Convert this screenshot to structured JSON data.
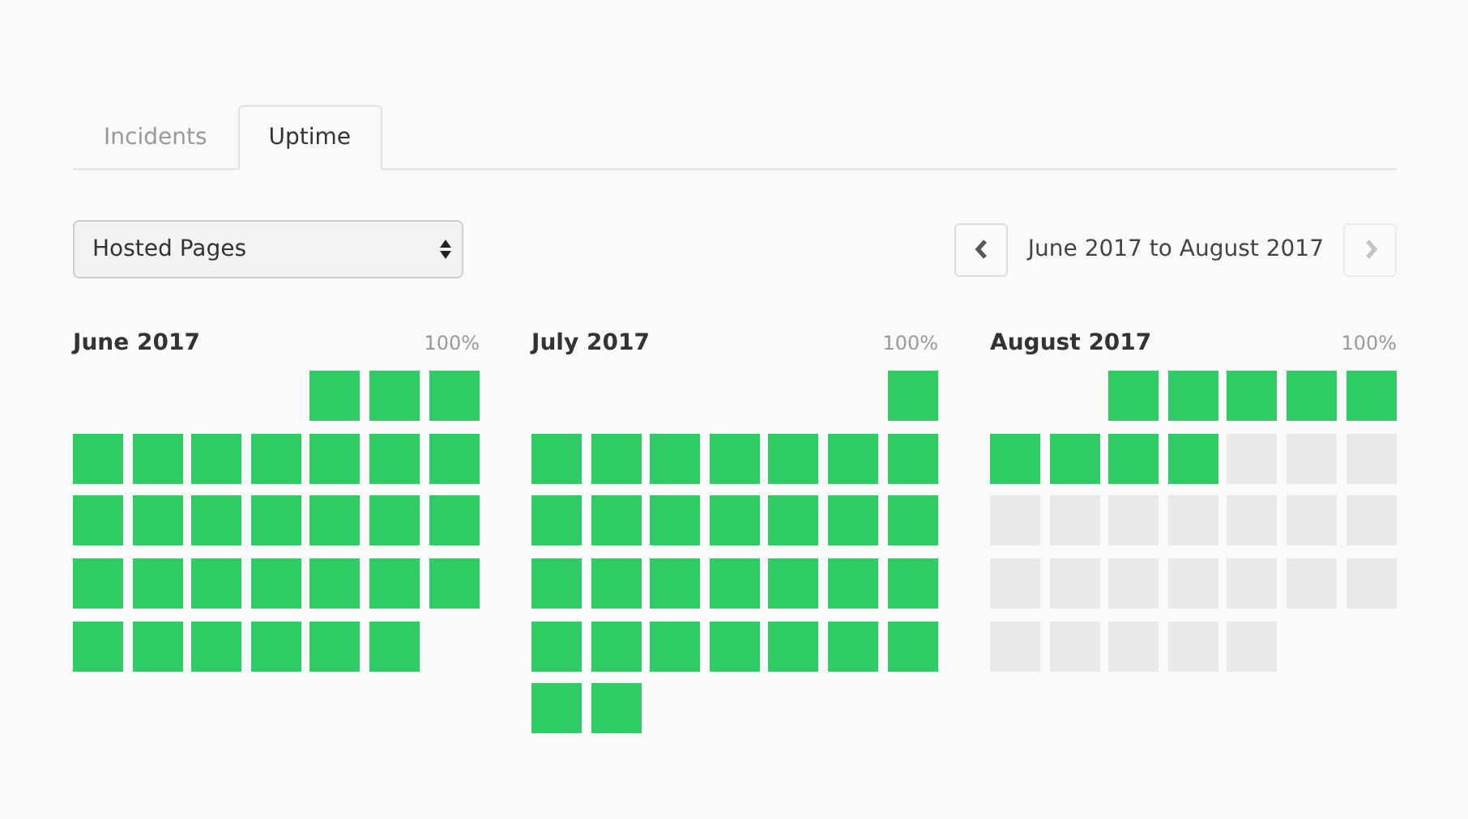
{
  "tabs": [
    {
      "label": "Incidents",
      "selected": false
    },
    {
      "label": "Uptime",
      "selected": true
    }
  ],
  "component_select": {
    "value": "Hosted Pages"
  },
  "range": {
    "label": "June 2017 to August 2017",
    "prev_disabled": false,
    "next_disabled": true
  },
  "months": [
    {
      "title": "June 2017",
      "uptime": "100%",
      "days": [
        {
          "kind": "blank"
        },
        {
          "kind": "blank"
        },
        {
          "kind": "blank"
        },
        {
          "kind": "blank"
        },
        {
          "kind": "up"
        },
        {
          "kind": "up"
        },
        {
          "kind": "up"
        },
        {
          "kind": "up"
        },
        {
          "kind": "up"
        },
        {
          "kind": "up"
        },
        {
          "kind": "up"
        },
        {
          "kind": "up"
        },
        {
          "kind": "up"
        },
        {
          "kind": "up"
        },
        {
          "kind": "up"
        },
        {
          "kind": "up"
        },
        {
          "kind": "up"
        },
        {
          "kind": "up"
        },
        {
          "kind": "up"
        },
        {
          "kind": "up"
        },
        {
          "kind": "up"
        },
        {
          "kind": "up"
        },
        {
          "kind": "up"
        },
        {
          "kind": "up"
        },
        {
          "kind": "up"
        },
        {
          "kind": "up"
        },
        {
          "kind": "up"
        },
        {
          "kind": "up"
        },
        {
          "kind": "up"
        },
        {
          "kind": "up"
        },
        {
          "kind": "up"
        },
        {
          "kind": "up"
        },
        {
          "kind": "up"
        },
        {
          "kind": "up"
        }
      ]
    },
    {
      "title": "July 2017",
      "uptime": "100%",
      "days": [
        {
          "kind": "blank"
        },
        {
          "kind": "blank"
        },
        {
          "kind": "blank"
        },
        {
          "kind": "blank"
        },
        {
          "kind": "blank"
        },
        {
          "kind": "blank"
        },
        {
          "kind": "up"
        },
        {
          "kind": "up"
        },
        {
          "kind": "up"
        },
        {
          "kind": "up"
        },
        {
          "kind": "up"
        },
        {
          "kind": "up"
        },
        {
          "kind": "up"
        },
        {
          "kind": "up"
        },
        {
          "kind": "up"
        },
        {
          "kind": "up"
        },
        {
          "kind": "up"
        },
        {
          "kind": "up"
        },
        {
          "kind": "up"
        },
        {
          "kind": "up"
        },
        {
          "kind": "up"
        },
        {
          "kind": "up"
        },
        {
          "kind": "up"
        },
        {
          "kind": "up"
        },
        {
          "kind": "up"
        },
        {
          "kind": "up"
        },
        {
          "kind": "up"
        },
        {
          "kind": "up"
        },
        {
          "kind": "up"
        },
        {
          "kind": "up"
        },
        {
          "kind": "up"
        },
        {
          "kind": "up"
        },
        {
          "kind": "up"
        },
        {
          "kind": "up"
        },
        {
          "kind": "up"
        },
        {
          "kind": "up"
        },
        {
          "kind": "up"
        }
      ]
    },
    {
      "title": "August 2017",
      "uptime": "100%",
      "days": [
        {
          "kind": "blank"
        },
        {
          "kind": "blank"
        },
        {
          "kind": "up"
        },
        {
          "kind": "up"
        },
        {
          "kind": "up"
        },
        {
          "kind": "up"
        },
        {
          "kind": "up"
        },
        {
          "kind": "up"
        },
        {
          "kind": "up"
        },
        {
          "kind": "up"
        },
        {
          "kind": "up"
        },
        {
          "kind": "none"
        },
        {
          "kind": "none"
        },
        {
          "kind": "none"
        },
        {
          "kind": "none"
        },
        {
          "kind": "none"
        },
        {
          "kind": "none"
        },
        {
          "kind": "none"
        },
        {
          "kind": "none"
        },
        {
          "kind": "none"
        },
        {
          "kind": "none"
        },
        {
          "kind": "none"
        },
        {
          "kind": "none"
        },
        {
          "kind": "none"
        },
        {
          "kind": "none"
        },
        {
          "kind": "none"
        },
        {
          "kind": "none"
        },
        {
          "kind": "none"
        },
        {
          "kind": "none"
        },
        {
          "kind": "none"
        },
        {
          "kind": "none"
        },
        {
          "kind": "none"
        },
        {
          "kind": "none"
        }
      ]
    }
  ]
}
